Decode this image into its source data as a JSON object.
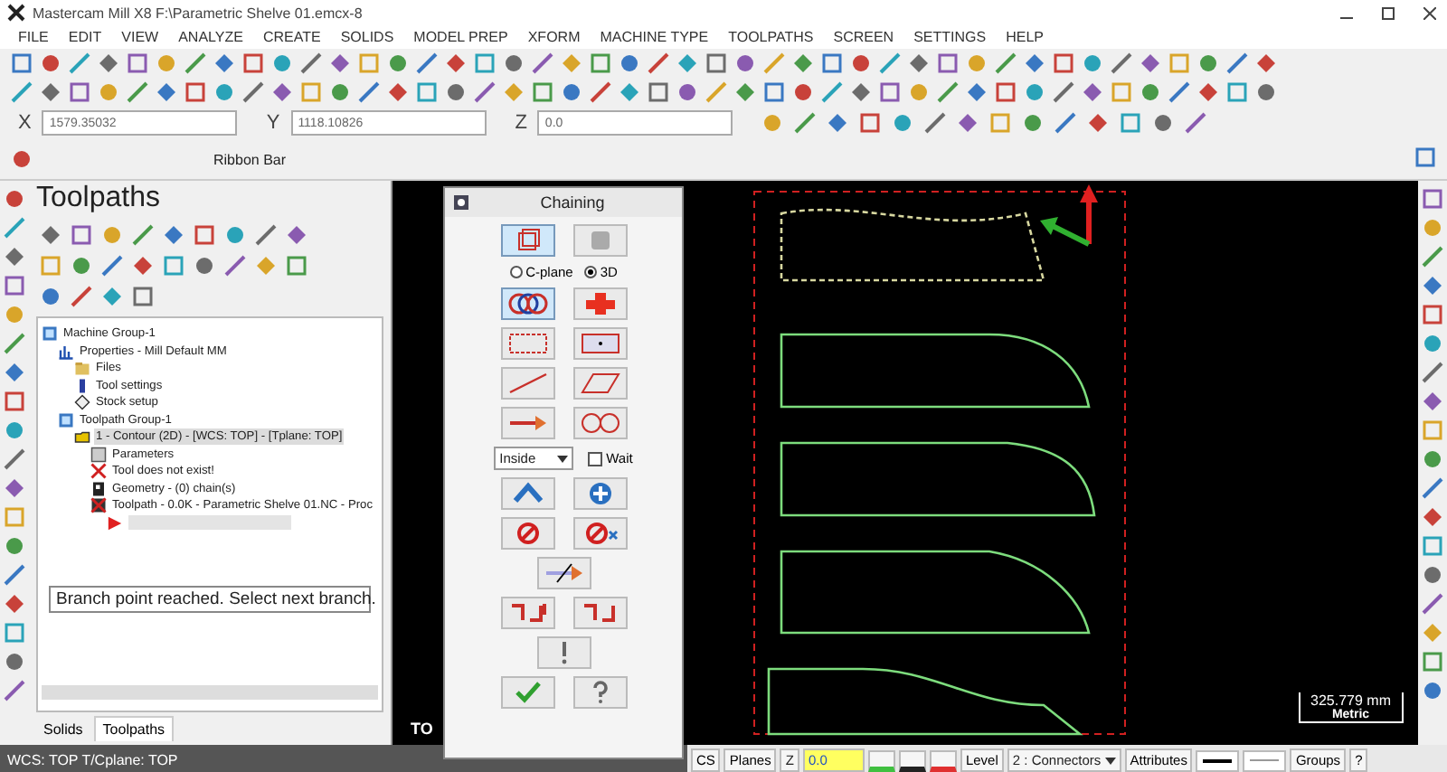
{
  "window": {
    "title": "Mastercam Mill X8  F:\\Parametric Shelve 01.emcx-8"
  },
  "menu": [
    "FILE",
    "EDIT",
    "VIEW",
    "ANALYZE",
    "CREATE",
    "SOLIDS",
    "MODEL PREP",
    "XFORM",
    "MACHINE TYPE",
    "TOOLPATHS",
    "SCREEN",
    "SETTINGS",
    "HELP"
  ],
  "coords": [
    {
      "label": "X",
      "value": "1579.35032"
    },
    {
      "label": "Y",
      "value": "1118.10826"
    },
    {
      "label": "Z",
      "value": "0.0"
    }
  ],
  "ribbon_bar": {
    "label": "Ribbon Bar"
  },
  "toolpaths_panel": {
    "title": "Toolpaths",
    "tree": [
      {
        "label": "Machine Group-1",
        "kind": "group",
        "selected": false,
        "children": [
          {
            "label": "Properties - Mill Default MM",
            "kind": "properties",
            "selected": false,
            "children": [
              {
                "label": "Files",
                "kind": "files",
                "selected": false
              },
              {
                "label": "Tool settings",
                "kind": "tool",
                "selected": false
              },
              {
                "label": "Stock setup",
                "kind": "stock",
                "selected": false
              }
            ]
          },
          {
            "label": "Toolpath Group-1",
            "kind": "group",
            "selected": false,
            "children": [
              {
                "label": "1 - Contour (2D) - [WCS: TOP] - [Tplane: TOP]",
                "kind": "operation",
                "selected": true,
                "children": [
                  {
                    "label": "Parameters",
                    "kind": "parameters",
                    "selected": false
                  },
                  {
                    "label": "Tool does not exist!",
                    "kind": "error",
                    "selected": false
                  },
                  {
                    "label": "Geometry - (0) chain(s)",
                    "kind": "geometry",
                    "selected": false
                  },
                  {
                    "label": "Toolpath - 0.0K - Parametric Shelve 01.NC - Proc",
                    "kind": "toolpath",
                    "selected": false
                  }
                ]
              }
            ]
          }
        ]
      }
    ],
    "message": "Branch point reached.  Select next branch.",
    "tabs": [
      {
        "label": "Solids",
        "selected": false
      },
      {
        "label": "Toolpaths",
        "selected": true
      }
    ]
  },
  "chaining": {
    "title": "Chaining",
    "plane_options": [
      {
        "label": "C-plane",
        "selected": false
      },
      {
        "label": "3D",
        "selected": true
      }
    ],
    "mode": "Inside",
    "wait": {
      "label": "Wait",
      "checked": false
    }
  },
  "viewport": {
    "view_label": "TO",
    "scale": "325.779 mm",
    "units": "Metric"
  },
  "status": {
    "text": "WCS: TOP  T/Cplane: TOP"
  },
  "bottom_bar": {
    "wcs": "CS",
    "planes": "Planes",
    "z_label": "Z",
    "z_value": "0.0",
    "level_label": "Level",
    "level_value": "2 : Connectors",
    "attributes": "Attributes",
    "groups": "Groups",
    "help": "?"
  }
}
